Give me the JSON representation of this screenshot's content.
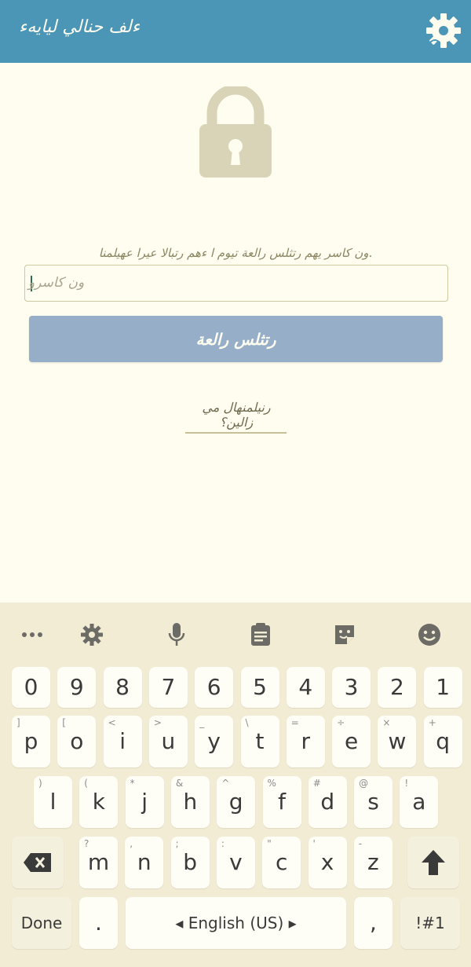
{
  "app_bar": {
    "title": "ءلف حنالي ليايهء",
    "gear_icon": "gear-icon"
  },
  "lock_icon": "lock-icon",
  "hint_text": "ون كاسر يهم رتثلس رالعة تيوم ا ءهم رتبالا عيرا عهيلمنا.",
  "password_input": {
    "placeholder": "ون كاسرو"
  },
  "login_button": {
    "label": "رتثلس رالعة"
  },
  "forgot_link": {
    "label": "رنيلمنهال مي زالين؟"
  },
  "keyboard": {
    "toolbar_icons": [
      "more-icon",
      "settings-icon",
      "mic-icon",
      "clipboard-icon",
      "sticker-icon",
      "emoji-icon"
    ],
    "row_numbers": [
      "0",
      "9",
      "8",
      "7",
      "6",
      "5",
      "4",
      "3",
      "2",
      "1"
    ],
    "row1": [
      {
        "ch": "p",
        "sub": "]"
      },
      {
        "ch": "o",
        "sub": "["
      },
      {
        "ch": "i",
        "sub": "<"
      },
      {
        "ch": "u",
        "sub": ">"
      },
      {
        "ch": "y",
        "sub": "_"
      },
      {
        "ch": "t",
        "sub": "\\"
      },
      {
        "ch": "r",
        "sub": "="
      },
      {
        "ch": "e",
        "sub": "÷"
      },
      {
        "ch": "w",
        "sub": "×"
      },
      {
        "ch": "q",
        "sub": "+"
      }
    ],
    "row2": [
      {
        "ch": "l",
        "sub": ")"
      },
      {
        "ch": "k",
        "sub": "("
      },
      {
        "ch": "j",
        "sub": "*"
      },
      {
        "ch": "h",
        "sub": "&"
      },
      {
        "ch": "g",
        "sub": "^"
      },
      {
        "ch": "f",
        "sub": "%"
      },
      {
        "ch": "d",
        "sub": "#"
      },
      {
        "ch": "s",
        "sub": "@"
      },
      {
        "ch": "a",
        "sub": "!"
      }
    ],
    "row3": [
      {
        "ch": "m",
        "sub": "?"
      },
      {
        "ch": "n",
        "sub": ","
      },
      {
        "ch": "b",
        "sub": ";"
      },
      {
        "ch": "v",
        "sub": ":"
      },
      {
        "ch": "c",
        "sub": "\""
      },
      {
        "ch": "x",
        "sub": "'"
      },
      {
        "ch": "z",
        "sub": "-"
      }
    ],
    "done_label": "Done",
    "period_label": ".",
    "space_label": "◂ English (US) ▸",
    "comma_label": ",",
    "symbols_label": "!#1"
  }
}
